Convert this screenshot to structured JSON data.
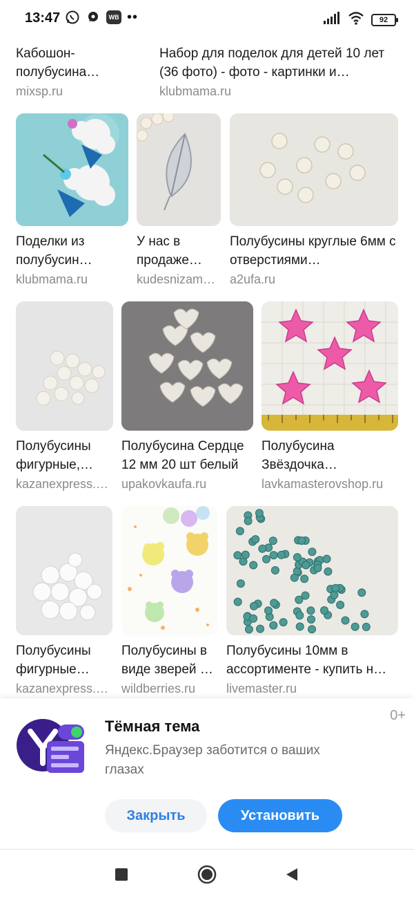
{
  "status_bar": {
    "time": "13:47",
    "battery": "92",
    "wb_label": "WB",
    "icons": [
      "whatsapp-icon",
      "chat-bubble-icon",
      "wb-app-icon",
      "more-dots-icon",
      "signal-icon",
      "wifi-icon",
      "battery-icon"
    ]
  },
  "results": [
    {
      "title": "Кабошон-полубусина…",
      "source": "mixsp.ru"
    },
    {
      "title": "Набор для поделок для детей 10 лет (36 фото) - фото - картинки и…",
      "source": "klubmama.ru"
    },
    {
      "title": "Поделки из полубусин…",
      "source": "klubmama.ru"
    },
    {
      "title": "У нас в продаже…",
      "source": "kudesnizam…"
    },
    {
      "title": "Полубусины круглые 6мм с отверстиями…",
      "source": "a2ufa.ru"
    },
    {
      "title": "Полубусины фигурные,…",
      "source": "kazanexpress.…"
    },
    {
      "title": "Полубусина Сердце 12 мм 20 шт белый",
      "source": "upakovkaufa.ru"
    },
    {
      "title": "Полубусина Звёздочка…",
      "source": "lavkamasterovshop.ru"
    },
    {
      "title": "Полубусины фигурные…",
      "source": "kazanexpress.…"
    },
    {
      "title": "Полубусины в виде зверей …",
      "source": "wildberries.ru"
    },
    {
      "title": "Полубусины 10мм в ассортименте - купить н…",
      "source": "livemaster.ru"
    }
  ],
  "promo": {
    "age_rating": "0+",
    "title": "Тёмная тема",
    "description": "Яндекс.Браузер заботится о ваших глазах",
    "close_label": "Закрыть",
    "install_label": "Установить",
    "accent_color": "#2a8cf2"
  },
  "nav": {
    "icons": [
      "recent-apps-icon",
      "home-icon",
      "back-icon"
    ]
  }
}
